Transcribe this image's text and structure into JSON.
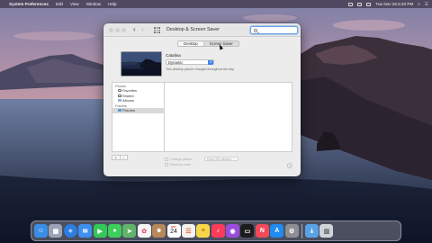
{
  "menubar": {
    "app_name": "System Preferences",
    "items": [
      "Edit",
      "View",
      "Window",
      "Help"
    ],
    "clock": "Tue Nov 26 5:40 PM"
  },
  "window": {
    "title": "Desktop & Screen Saver",
    "search": {
      "placeholder": "",
      "value": ""
    },
    "tabs": [
      {
        "label": "Desktop",
        "active": false
      },
      {
        "label": "Screen Saver",
        "active": true
      }
    ],
    "preview": {
      "name": "Catalina",
      "style_value": "Dynamic",
      "description": "This desktop picture changes throughout the day."
    },
    "sources": {
      "photos_header": "Photos",
      "photos_items": [
        {
          "label": "Favorites",
          "icon": "heart-icon"
        },
        {
          "label": "Shared",
          "icon": "cloud-icon"
        },
        {
          "label": "Albums",
          "icon": "album-icon"
        }
      ],
      "folders_header": "Folders",
      "folders_items": [
        {
          "label": "Pictures",
          "icon": "folder-icon",
          "selected": true
        }
      ]
    },
    "bottom": {
      "add_label": "+",
      "remove_label": "−",
      "change_picture_label": "Change picture:",
      "interval_value": "Every 30 minutes",
      "random_order_label": "Random order",
      "help_label": "?"
    }
  },
  "dock": {
    "apps": [
      {
        "name": "finder-icon",
        "color": "#3a8ee6"
      },
      {
        "name": "launchpad-icon",
        "color": "#9aa4b4"
      },
      {
        "name": "safari-icon",
        "color": "#2b7de0"
      },
      {
        "name": "mail-icon",
        "color": "#3d8ff0"
      },
      {
        "name": "facetime-icon",
        "color": "#34c759"
      },
      {
        "name": "messages-icon",
        "color": "#3ccf5a"
      },
      {
        "name": "maps-icon",
        "color": "#62b46a"
      },
      {
        "name": "photos-icon",
        "color": "#f5f5f5"
      },
      {
        "name": "contacts-icon",
        "color": "#b7885a"
      },
      {
        "name": "calendar-icon",
        "color": "#ffffff"
      },
      {
        "name": "reminders-icon",
        "color": "#f2f2f2"
      },
      {
        "name": "notes-icon",
        "color": "#f8d649"
      },
      {
        "name": "music-icon",
        "color": "#fa3b5a"
      },
      {
        "name": "podcasts-icon",
        "color": "#9b4ddb"
      },
      {
        "name": "tv-icon",
        "color": "#1c1c1e"
      },
      {
        "name": "news-icon",
        "color": "#f04a5a"
      },
      {
        "name": "app-store-icon",
        "color": "#1e8cf0"
      },
      {
        "name": "system-preferences-icon",
        "color": "#8e8e93"
      }
    ],
    "calendar": {
      "month": "NOV",
      "day": "24"
    },
    "extras": [
      {
        "name": "downloads-folder-icon",
        "color": "#5aa2e6"
      },
      {
        "name": "trash-icon",
        "color": "#cfd4da"
      }
    ]
  }
}
